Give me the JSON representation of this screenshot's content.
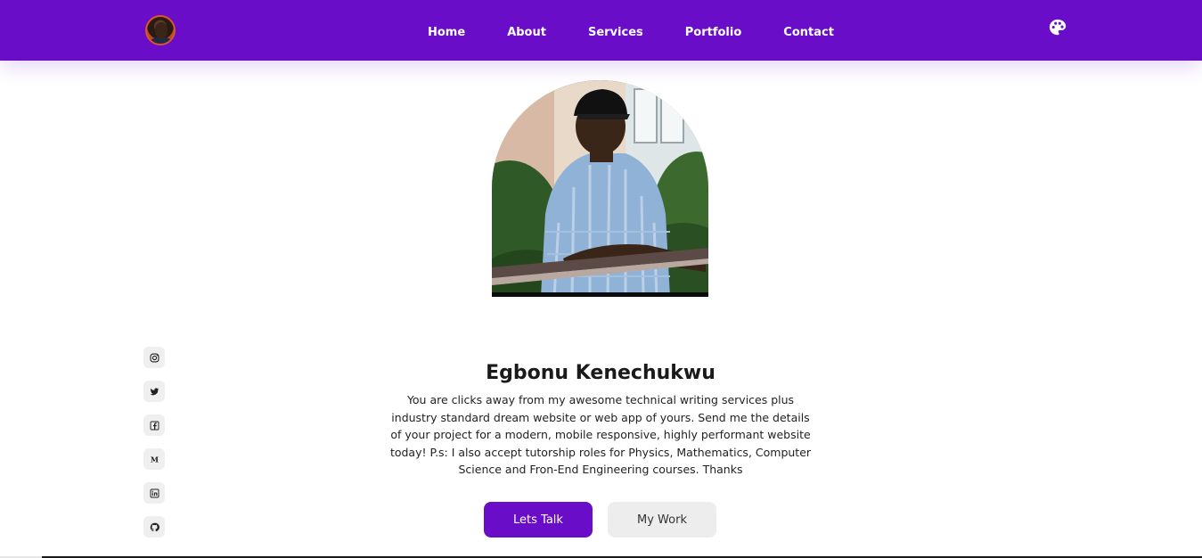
{
  "header": {
    "nav": [
      {
        "label": "Home"
      },
      {
        "label": "About"
      },
      {
        "label": "Services"
      },
      {
        "label": "Portfolio"
      },
      {
        "label": "Contact"
      }
    ],
    "theme_icon": "palette-icon",
    "brand_color": "#6a0dc8"
  },
  "hero": {
    "name": "Egbonu Kenechukwu",
    "description": "You are clicks away from my awesome technical writing services plus industry standard dream website or web app of yours. Send me the details of your project for a modern, mobile responsive, highly performant website today! P.s: I also accept tutorship roles for Physics, Mathematics, Computer Science and Fron-End Engineering courses. Thanks",
    "primary_button": "Lets Talk",
    "secondary_button": "My Work"
  },
  "socials": [
    {
      "icon": "instagram-icon"
    },
    {
      "icon": "twitter-icon"
    },
    {
      "icon": "facebook-icon"
    },
    {
      "icon": "medium-icon"
    },
    {
      "icon": "linkedin-icon"
    },
    {
      "icon": "github-icon"
    }
  ]
}
